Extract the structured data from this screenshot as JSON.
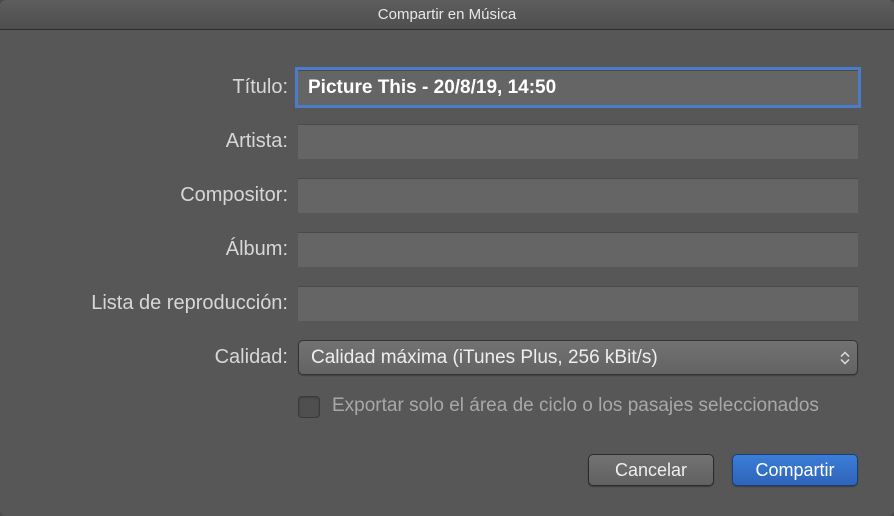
{
  "window": {
    "title": "Compartir en Música"
  },
  "form": {
    "title_label": "Título:",
    "title_value": "Picture This - 20/8/19, 14:50",
    "artist_label": "Artista:",
    "artist_value": "",
    "composer_label": "Compositor:",
    "composer_value": "",
    "album_label": "Álbum:",
    "album_value": "",
    "playlist_label": "Lista de reproducción:",
    "playlist_value": "",
    "quality_label": "Calidad:",
    "quality_value": "Calidad máxima (iTunes Plus, 256 kBit/s)",
    "export_cycle_label": "Exportar solo el área de ciclo o los pasajes seleccionados"
  },
  "buttons": {
    "cancel": "Cancelar",
    "share": "Compartir"
  }
}
